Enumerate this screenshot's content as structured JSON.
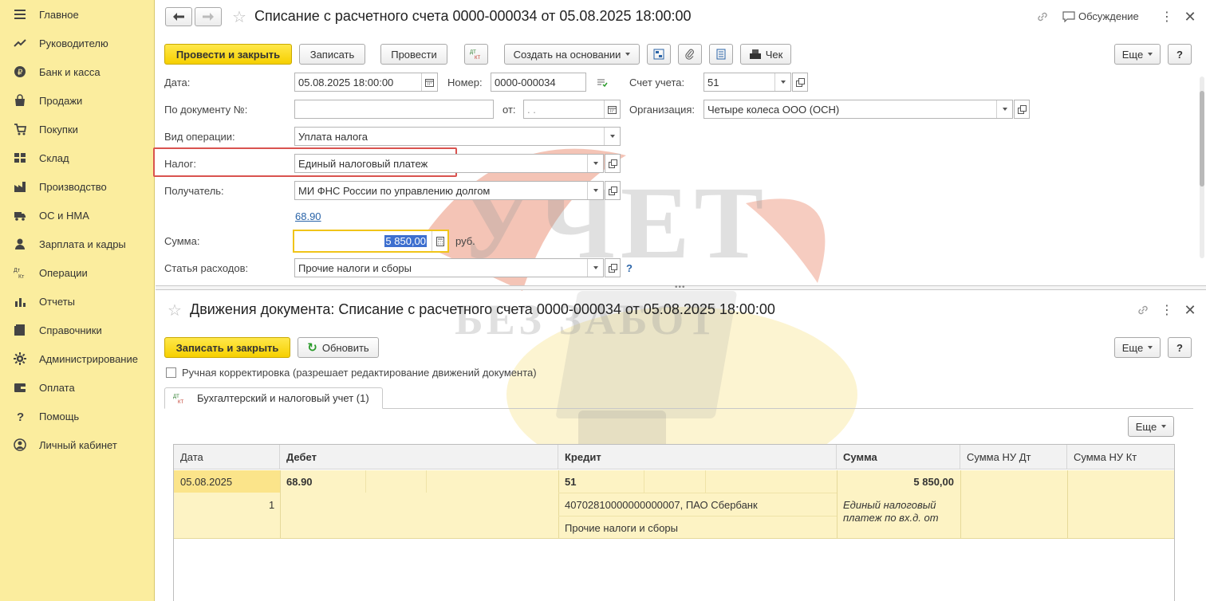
{
  "sidebar": {
    "items": [
      {
        "label": "Главное",
        "icon": "menu-icon"
      },
      {
        "label": "Руководителю",
        "icon": "trend-icon"
      },
      {
        "label": "Банк и касса",
        "icon": "coin-icon"
      },
      {
        "label": "Продажи",
        "icon": "bag-icon"
      },
      {
        "label": "Покупки",
        "icon": "cart-icon"
      },
      {
        "label": "Склад",
        "icon": "warehouse-icon"
      },
      {
        "label": "Производство",
        "icon": "factory-icon"
      },
      {
        "label": "ОС и НМА",
        "icon": "truck-icon"
      },
      {
        "label": "Зарплата и кадры",
        "icon": "person-icon"
      },
      {
        "label": "Операции",
        "icon": "dt-kt-icon"
      },
      {
        "label": "Отчеты",
        "icon": "bar-chart-icon"
      },
      {
        "label": "Справочники",
        "icon": "book-icon"
      },
      {
        "label": "Администрирование",
        "icon": "gear-icon"
      },
      {
        "label": "Оплата",
        "icon": "wallet-icon"
      },
      {
        "label": "Помощь",
        "icon": "question-icon"
      },
      {
        "label": "Личный кабинет",
        "icon": "user-circle-icon"
      }
    ]
  },
  "doc": {
    "title": "Списание с расчетного счета 0000-000034 от 05.08.2025 18:00:00",
    "discussion": "Обсуждение",
    "toolbar": {
      "post_close": "Провести и закрыть",
      "save": "Записать",
      "post": "Провести",
      "create_based": "Создать на основании",
      "check": "Чек",
      "more": "Еще",
      "help": "?"
    },
    "fields": {
      "date_label": "Дата:",
      "date_value": "05.08.2025 18:00:00",
      "number_label": "Номер:",
      "number_value": "0000-000034",
      "account_label": "Счет учета:",
      "account_value": "51",
      "by_doc_label": "По документу №:",
      "by_doc_value": "",
      "from_label": "от:",
      "from_value": " .  .",
      "org_label": "Организация:",
      "org_value": "Четыре колеса ООО (ОСН)",
      "op_label": "Вид операции:",
      "op_value": "Уплата налога",
      "tax_label": "Налог:",
      "tax_value": "Единый налоговый платеж",
      "recipient_label": "Получатель:",
      "recipient_value": "МИ ФНС России по управлению долгом",
      "account_link": "68.90",
      "sum_label": "Сумма:",
      "sum_value": "5 850,00",
      "currency": "руб.",
      "expense_label": "Статья расходов:",
      "expense_value": "Прочие налоги и сборы",
      "expense_help": "?"
    }
  },
  "moves": {
    "title": "Движения документа: Списание с расчетного счета 0000-000034 от 05.08.2025 18:00:00",
    "save_close": "Записать и закрыть",
    "refresh": "Обновить",
    "more": "Еще",
    "help": "?",
    "manual_label": "Ручная корректировка (разрешает редактирование движений документа)",
    "tab_label": "Бухгалтерский и налоговый учет (1)",
    "grid_more": "Еще",
    "columns": [
      "Дата",
      "Дебет",
      "Кредит",
      "Сумма",
      "Сумма НУ Дт",
      "Сумма НУ Кт"
    ],
    "row": {
      "date": "05.08.2025",
      "num": "1",
      "debit": "68.90",
      "credit": "51",
      "credit_sub1": "40702810000000000007, ПАО Сбербанк",
      "credit_sub2": "Прочие налоги и сборы",
      "sum": "5 850,00",
      "content_line1": "Единый налоговый",
      "content_line2": "платеж по вх.д.  от"
    }
  },
  "watermark": {
    "line1": "УЧЕТ",
    "line2": "БЕЗ ЗАБОТ"
  },
  "colors": {
    "sidebar_bg": "#fbed9e",
    "primary_button": "#f6d000",
    "highlight_row": "#fdf3c4",
    "annotation_red": "#d9534f",
    "link": "#2a64a8"
  }
}
